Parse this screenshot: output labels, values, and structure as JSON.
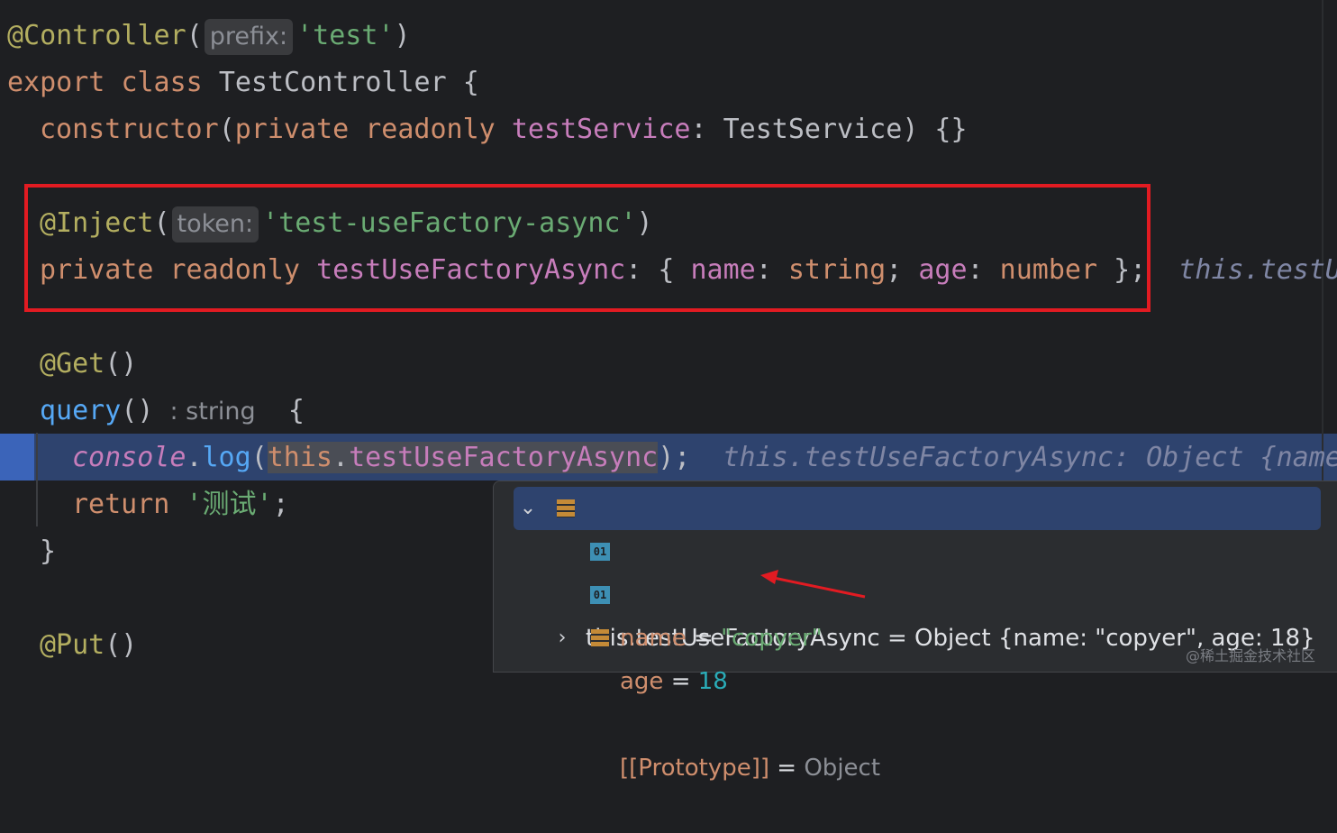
{
  "code": {
    "l1": {
      "decorator": "@Controller",
      "hint": "prefix:",
      "arg": "'test'"
    },
    "l2": {
      "export": "export",
      "class": "class",
      "name": "TestController",
      "brace": "{"
    },
    "l3": {
      "ctor": "constructor",
      "private": "private",
      "readonly": "readonly",
      "param": "testService",
      "type": "TestService",
      "tail": ") {}"
    },
    "l5": {
      "decorator": "@Inject",
      "hint": "token:",
      "arg": "'test-useFactory-async'"
    },
    "l6": {
      "private": "private",
      "readonly": "readonly",
      "prop": "testUseFactoryAsync",
      "name_key": "name",
      "name_type": "string",
      "age_key": "age",
      "age_type": "number",
      "inline_eval": "this.testU"
    },
    "l8": {
      "decorator": "@Get",
      "parens": "()"
    },
    "l9": {
      "method": "query",
      "parens": "()",
      "typehint": ": string",
      "brace": "{"
    },
    "l10": {
      "console": "console",
      "log": "log",
      "this": "this",
      "prop": "testUseFactoryAsync",
      "inline_eval": "this.testUseFactoryAsync: Object {name"
    },
    "l11": {
      "return": "return",
      "value": "'测试'"
    },
    "l12": {
      "brace": "}"
    },
    "l14": {
      "decorator": "@Put",
      "parens": "()"
    }
  },
  "debug_popup": {
    "root": {
      "expr": "this.testUseFactoryAsync",
      "eq": " = ",
      "value": "Object {name: \"copyer\", age: 18}"
    },
    "children": [
      {
        "icon": "field",
        "icon_text": "01",
        "key": "name",
        "eq": " = ",
        "value": "\"copyer\""
      },
      {
        "icon": "field",
        "icon_text": "01",
        "key": "age",
        "eq": " = ",
        "value": "18"
      },
      {
        "icon": "object",
        "key": "[[Prototype]]",
        "eq": " = ",
        "value": "Object"
      }
    ]
  },
  "watermark": "@稀土掘金技术社区",
  "colors": {
    "highlight_box": "#e21b22",
    "arrow": "#e21b22",
    "exec_line": "#2e436e"
  }
}
